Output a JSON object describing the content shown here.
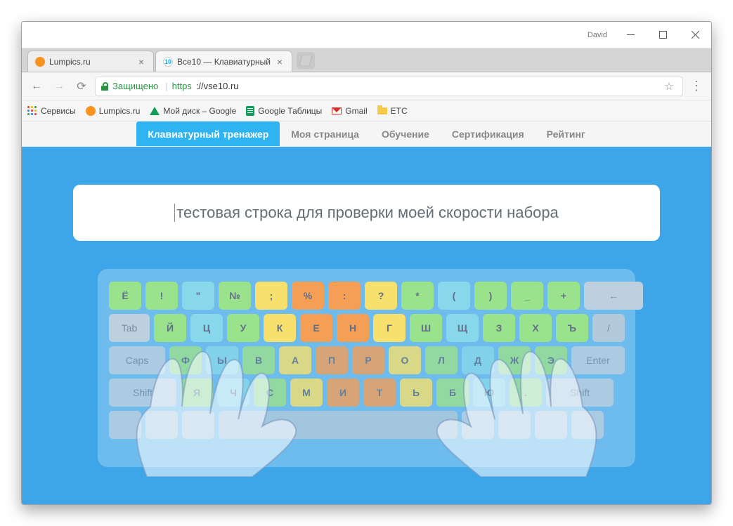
{
  "window": {
    "user": "David"
  },
  "tabs": [
    {
      "title": "Lumpics.ru",
      "favicon": "orange",
      "active": false
    },
    {
      "title": "Все10 — Клавиатурный",
      "favicon": "blue10",
      "active": true
    }
  ],
  "address": {
    "secure_label": "Защищено",
    "proto": "https",
    "host": "://vse10.ru"
  },
  "bookmarks": [
    {
      "icon": "apps",
      "label": "Сервисы"
    },
    {
      "icon": "orange",
      "label": "Lumpics.ru"
    },
    {
      "icon": "drive",
      "label": "Мой диск – Google"
    },
    {
      "icon": "sheets",
      "label": "Google Таблицы"
    },
    {
      "icon": "gmail",
      "label": "Gmail"
    },
    {
      "icon": "folder",
      "label": "ETC"
    }
  ],
  "site_nav": [
    "Клавиатурный тренажер",
    "Моя страница",
    "Обучение",
    "Сертификация",
    "Рейтинг"
  ],
  "typing_text": "тестовая строка для проверки моей скорости набора",
  "keyboard": {
    "row1": [
      {
        "l": "Ё",
        "c": "c-grn",
        "w": "ksm"
      },
      {
        "l": "!",
        "c": "c-grn",
        "w": "ksm"
      },
      {
        "l": "\"",
        "c": "c-cyan",
        "w": "ksm"
      },
      {
        "l": "№",
        "c": "c-grn",
        "w": "ksm"
      },
      {
        "l": ";",
        "c": "c-yel",
        "w": "ksm"
      },
      {
        "l": "%",
        "c": "c-orng",
        "w": "ksm"
      },
      {
        "l": ":",
        "c": "c-orng",
        "w": "ksm"
      },
      {
        "l": "?",
        "c": "c-yel",
        "w": "ksm"
      },
      {
        "l": "*",
        "c": "c-grn",
        "w": "ksm"
      },
      {
        "l": "(",
        "c": "c-cyan",
        "w": "ksm"
      },
      {
        "l": ")",
        "c": "c-grn",
        "w": "ksm"
      },
      {
        "l": "_",
        "c": "c-grn",
        "w": "ksm"
      },
      {
        "l": "+",
        "c": "c-grn",
        "w": "ksm"
      },
      {
        "l": "←",
        "c": "c-gray",
        "w": "kback"
      }
    ],
    "row2_lead": {
      "l": "Tab",
      "c": "c-gray",
      "w": "kmd"
    },
    "row2": [
      {
        "l": "Й",
        "c": "c-grn"
      },
      {
        "l": "Ц",
        "c": "c-cyan"
      },
      {
        "l": "У",
        "c": "c-grn"
      },
      {
        "l": "К",
        "c": "c-yel"
      },
      {
        "l": "Е",
        "c": "c-orng"
      },
      {
        "l": "Н",
        "c": "c-orng"
      },
      {
        "l": "Г",
        "c": "c-yel"
      },
      {
        "l": "Ш",
        "c": "c-grn"
      },
      {
        "l": "Щ",
        "c": "c-cyan"
      },
      {
        "l": "З",
        "c": "c-grn"
      },
      {
        "l": "Х",
        "c": "c-grn"
      },
      {
        "l": "Ъ",
        "c": "c-grn"
      },
      {
        "l": "/",
        "c": "c-gray2"
      }
    ],
    "row3_lead": {
      "l": "Caps",
      "c": "c-gray",
      "w": "klg"
    },
    "row3": [
      {
        "l": "Ф",
        "c": "c-grn"
      },
      {
        "l": "Ы",
        "c": "c-cyan"
      },
      {
        "l": "В",
        "c": "c-grn"
      },
      {
        "l": "А",
        "c": "c-yel"
      },
      {
        "l": "П",
        "c": "c-orng"
      },
      {
        "l": "Р",
        "c": "c-orng"
      },
      {
        "l": "О",
        "c": "c-yel"
      },
      {
        "l": "Л",
        "c": "c-grn"
      },
      {
        "l": "Д",
        "c": "c-cyan"
      },
      {
        "l": "Ж",
        "c": "c-grn"
      },
      {
        "l": "Э",
        "c": "c-grn"
      }
    ],
    "row3_tail": {
      "l": "Enter",
      "c": "c-gray",
      "w": "kenter"
    },
    "row4_lead": {
      "l": "Shift",
      "c": "c-gray",
      "w": "kxl"
    },
    "row4": [
      {
        "l": "Я",
        "c": "c-grn"
      },
      {
        "l": "Ч",
        "c": "c-cyan"
      },
      {
        "l": "С",
        "c": "c-grn"
      },
      {
        "l": "М",
        "c": "c-yel"
      },
      {
        "l": "И",
        "c": "c-orng"
      },
      {
        "l": "Т",
        "c": "c-orng"
      },
      {
        "l": "Ь",
        "c": "c-yel"
      },
      {
        "l": "Б",
        "c": "c-grn"
      },
      {
        "l": "Ю",
        "c": "c-cyan"
      },
      {
        "l": ".",
        "c": "c-grn"
      }
    ],
    "row4_tail": {
      "l": "Shift",
      "c": "c-gray",
      "w": "kxl"
    },
    "row5": [
      {
        "l": "",
        "c": "c-gray",
        "w": "ksm"
      },
      {
        "l": "",
        "c": "c-gray",
        "w": "ksm"
      },
      {
        "l": "",
        "c": "c-gray",
        "w": "ksm"
      },
      {
        "l": "",
        "c": "c-gray2",
        "w": "ksp"
      },
      {
        "l": "",
        "c": "c-gray",
        "w": "ksm"
      },
      {
        "l": "",
        "c": "c-gray",
        "w": "ksm"
      },
      {
        "l": "",
        "c": "c-gray",
        "w": "ksm"
      },
      {
        "l": "",
        "c": "c-gray",
        "w": "ksm"
      }
    ]
  }
}
